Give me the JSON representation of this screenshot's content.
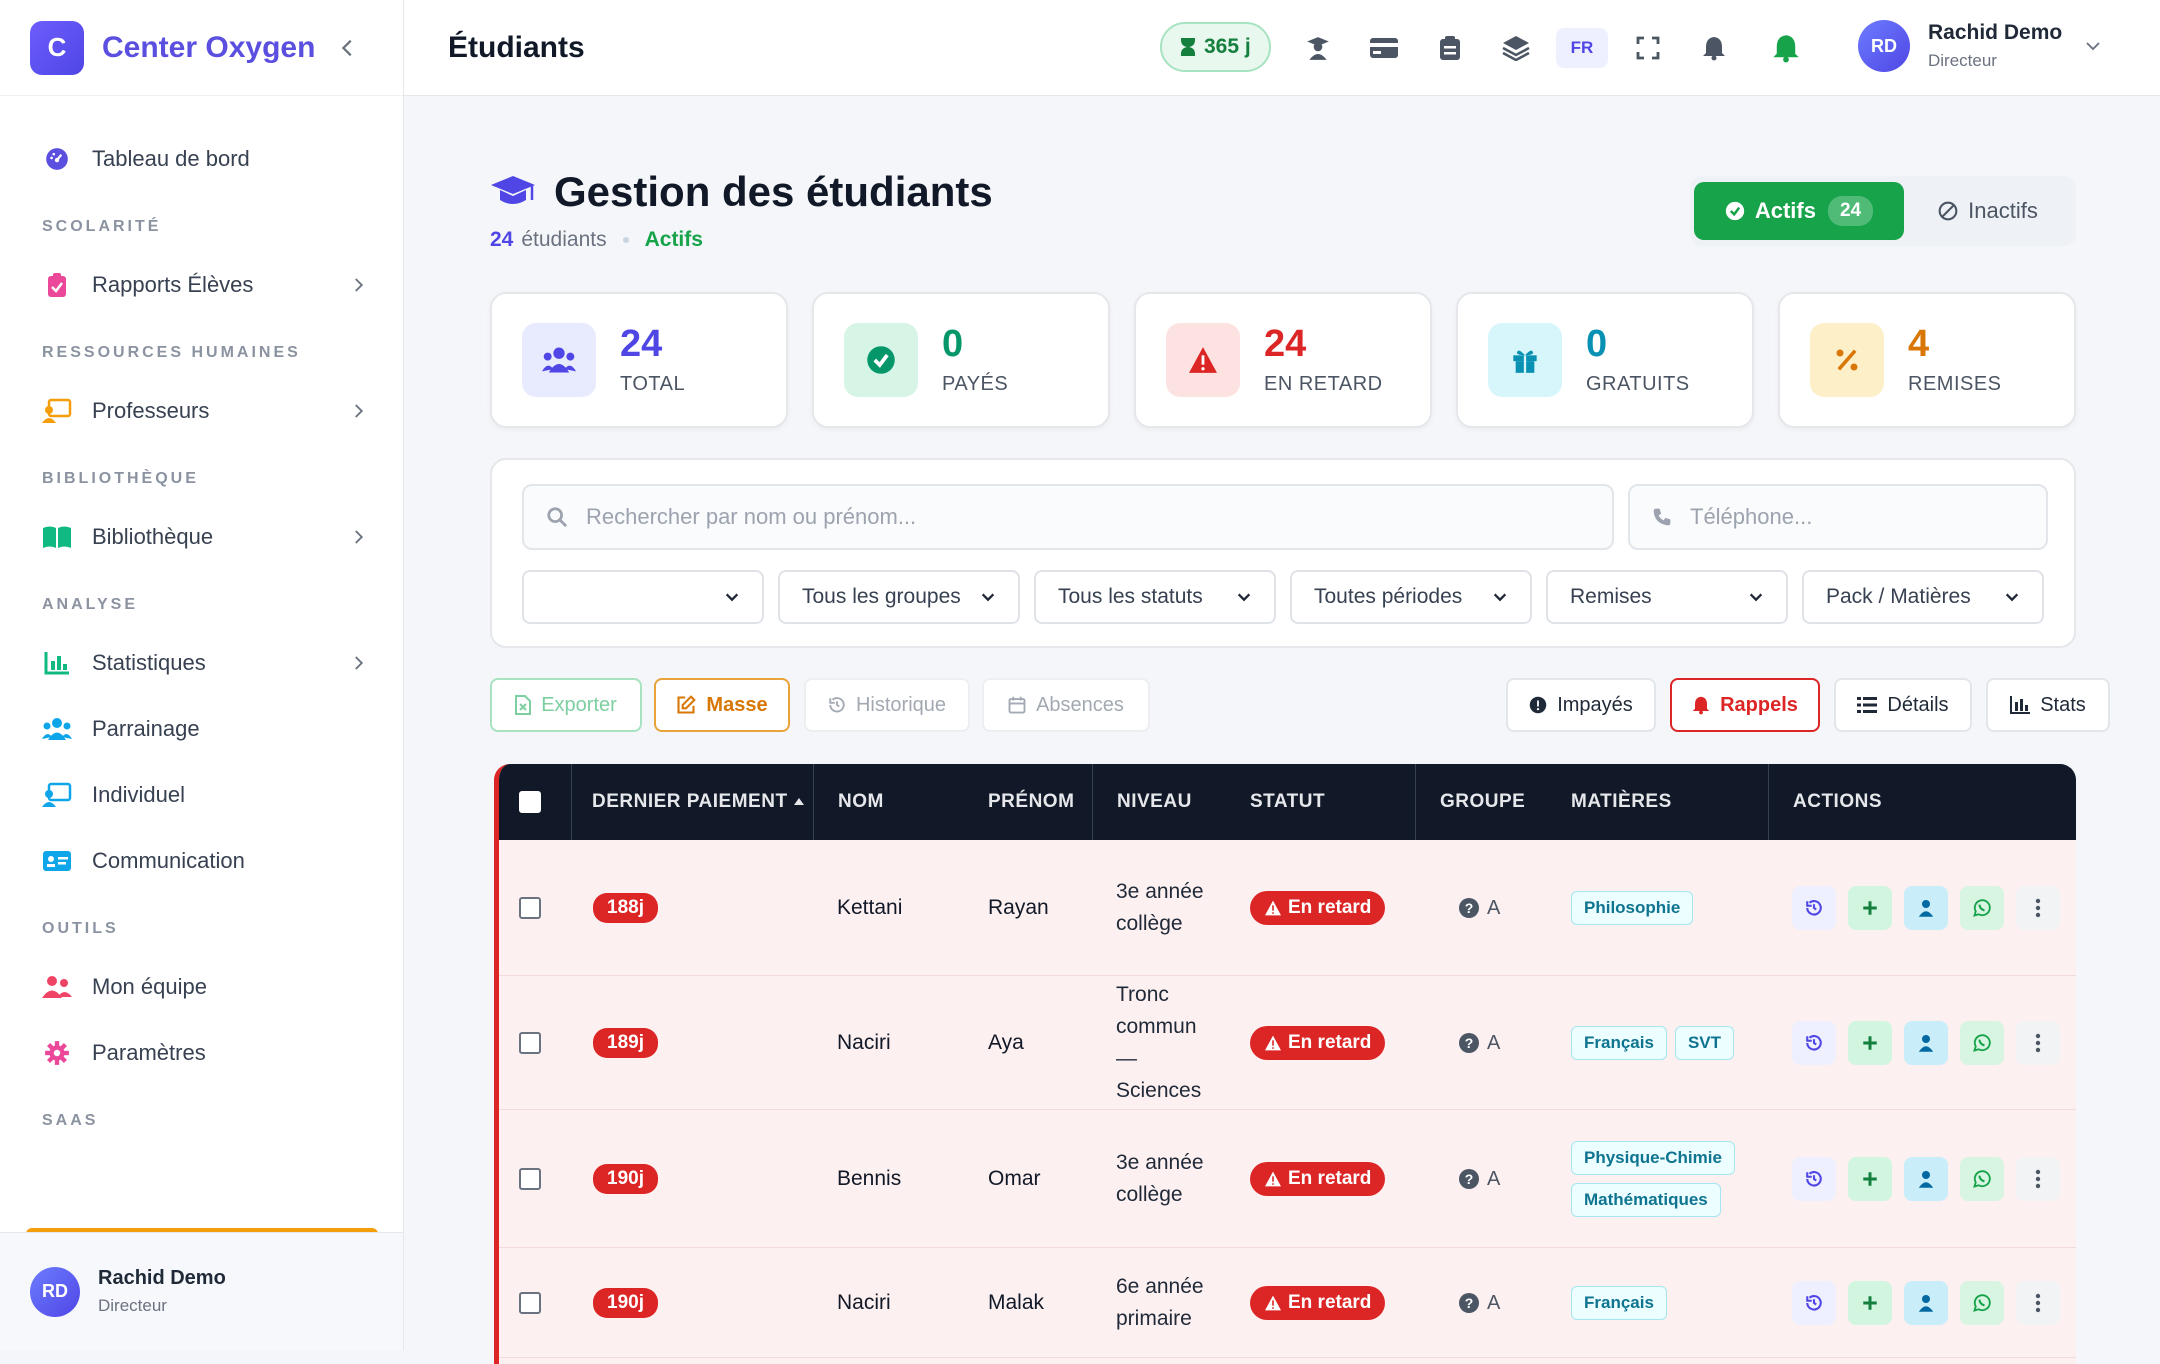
{
  "brand": {
    "logo_letter": "C",
    "name": "Center Oxygen"
  },
  "sidebar": {
    "top_item": {
      "label": "Tableau de bord",
      "icon": "dashboard-icon"
    },
    "sections": [
      {
        "title": "SCOLARITÉ",
        "items": [
          {
            "label": "Rapports Élèves",
            "icon": "clipboard-icon",
            "chevron": true
          }
        ]
      },
      {
        "title": "RESSOURCES HUMAINES",
        "items": [
          {
            "label": "Professeurs",
            "icon": "teacher-icon",
            "chevron": true
          }
        ]
      },
      {
        "title": "BIBLIOTHÈQUE",
        "items": [
          {
            "label": "Bibliothèque",
            "icon": "book-icon",
            "chevron": true
          }
        ]
      },
      {
        "title": "ANALYSE",
        "items": [
          {
            "label": "Statistiques",
            "icon": "chart-icon",
            "chevron": true
          },
          {
            "label": "Parrainage",
            "icon": "users-icon"
          },
          {
            "label": "Individuel",
            "icon": "teacher-board-icon"
          },
          {
            "label": "Communication",
            "icon": "id-card-icon"
          }
        ]
      },
      {
        "title": "OUTILS",
        "items": [
          {
            "label": "Mon équipe",
            "icon": "team-icon"
          },
          {
            "label": "Paramètres",
            "icon": "gear-icon"
          }
        ]
      },
      {
        "title": "SAAS",
        "items": []
      }
    ],
    "user": {
      "initials": "RD",
      "name": "Rachid Demo",
      "role": "Directeur"
    }
  },
  "topbar": {
    "title": "Étudiants",
    "days_left": "365 j",
    "lang": "FR",
    "user": {
      "initials": "RD",
      "name": "Rachid Demo",
      "role": "Directeur"
    }
  },
  "page": {
    "title": "Gestion des étudiants",
    "count": "24",
    "count_label": "étudiants",
    "status_label": "Actifs",
    "toggle": {
      "active_label": "Actifs",
      "active_count": "24",
      "inactive_label": "Inactifs"
    }
  },
  "stats": [
    {
      "value": "24",
      "label": "TOTAL",
      "color": "#4f46e5",
      "bg": "#e8eafe",
      "icon": "users-icon"
    },
    {
      "value": "0",
      "label": "PAYÉS",
      "color": "#059669",
      "bg": "#d6f5e6",
      "icon": "check-circle-icon"
    },
    {
      "value": "24",
      "label": "EN RETARD",
      "color": "#dc2626",
      "bg": "#fde2e2",
      "icon": "warning-icon"
    },
    {
      "value": "0",
      "label": "GRATUITS",
      "color": "#0891b2",
      "bg": "#d7f6fb",
      "icon": "gift-icon"
    },
    {
      "value": "4",
      "label": "REMISES",
      "color": "#d97706",
      "bg": "#fdf0c8",
      "icon": "percent-icon"
    }
  ],
  "filters": {
    "search_placeholder": "Rechercher par nom ou prénom...",
    "phone_placeholder": "Téléphone...",
    "selects": [
      "",
      "Tous les groupes",
      "Tous les statuts",
      "Toutes périodes",
      "Remises",
      "Pack / Matières"
    ]
  },
  "actions": {
    "export": "Exporter",
    "mass": "Masse",
    "history": "Historique",
    "absences": "Absences",
    "unpaid": "Impayés",
    "reminders": "Rappels",
    "details": "Détails",
    "stats": "Stats"
  },
  "table": {
    "headers": {
      "last_payment": "DERNIER PAIEMENT",
      "nom": "NOM",
      "prenom": "PRÉNOM",
      "niveau": "NIVEAU",
      "statut": "STATUT",
      "groupe": "GROUPE",
      "matieres": "MATIÈRES",
      "actions": "ACTIONS"
    },
    "rows": [
      {
        "days": "188j",
        "nom": "Kettani",
        "prenom": "Rayan",
        "niveau": [
          "3e année",
          "collège"
        ],
        "statut": "En retard",
        "groupe": "A",
        "matieres": [
          [
            "Philosophie"
          ]
        ]
      },
      {
        "days": "189j",
        "nom": "Naciri",
        "prenom": "Aya",
        "niveau": [
          "Tronc",
          "commun",
          "—",
          "Sciences"
        ],
        "statut": "En retard",
        "groupe": "A",
        "matieres": [
          [
            "Français",
            "SVT"
          ]
        ]
      },
      {
        "days": "190j",
        "nom": "Bennis",
        "prenom": "Omar",
        "niveau": [
          "3e année",
          "collège"
        ],
        "statut": "En retard",
        "groupe": "A",
        "matieres": [
          [
            "Physique-Chimie"
          ],
          [
            "Mathématiques"
          ]
        ]
      },
      {
        "days": "190j",
        "nom": "Naciri",
        "prenom": "Malak",
        "niveau": [
          "6e année",
          "primaire"
        ],
        "statut": "En retard",
        "groupe": "A",
        "matieres": [
          [
            "Français"
          ]
        ]
      }
    ]
  }
}
